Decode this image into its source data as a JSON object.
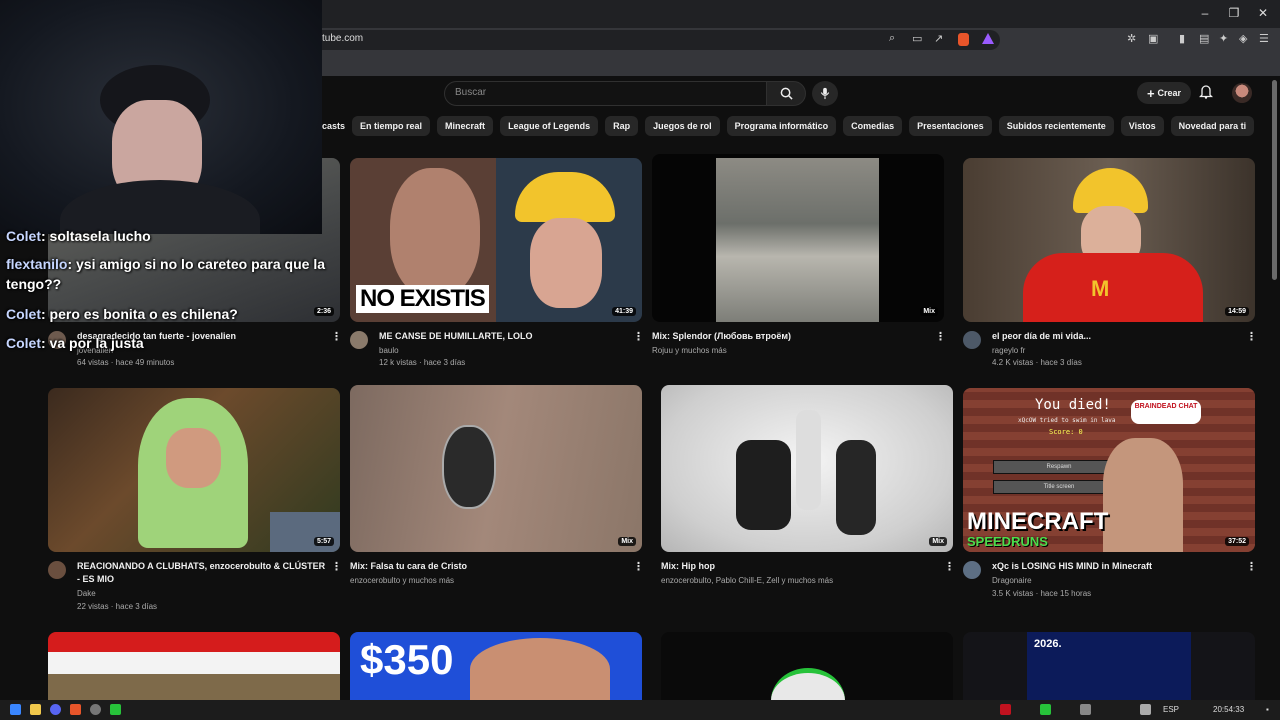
{
  "browser": {
    "url": "tube.com",
    "min": "–",
    "max": "❐",
    "close": "✕"
  },
  "header": {
    "search_placeholder": "Buscar",
    "create_label": "Crear"
  },
  "chips": [
    "casts",
    "En tiempo real",
    "Minecraft",
    "League of Legends",
    "Rap",
    "Juegos de rol",
    "Programa informático",
    "Comedias",
    "Presentaciones",
    "Subidos recientemente",
    "Vistos",
    "Novedad para ti"
  ],
  "videos": [
    {
      "title": "desagradecido tan fuerte - jovenalien",
      "channel": "jovenalien",
      "meta": "64 vistas · hace 49 minutos",
      "duration": "2:36"
    },
    {
      "title": "ME CANSE DE HUMILLARTE, LOLO",
      "channel": "baulo",
      "meta": "12 k vistas · hace 3 días",
      "duration": "41:39",
      "overlay": "NO EXISTIS"
    },
    {
      "title": "Mix: Splendor (Любовь втроём)",
      "channel": "Rojuu y muchos más",
      "meta": "",
      "duration": "Mix"
    },
    {
      "title": "el peor día de mi vida...",
      "channel": "rageylo fr",
      "meta": "4.2 K vistas · hace 3 días",
      "duration": "14:59"
    },
    {
      "title": "REACIONANDO A CLUBHATS, enzocerobulto & CLÚSTER - ES MIO",
      "channel": "Dake",
      "meta": "22 vistas · hace 3 días",
      "duration": "5:57"
    },
    {
      "title": "Mix: Falsa tu cara de Cristo",
      "channel": "enzocerobulto y muchos más",
      "meta": "",
      "duration": "Mix"
    },
    {
      "title": "Mix: Hip hop",
      "channel": "enzocerobulto, Pablo Chill-E, Zell y muchos más",
      "meta": "",
      "duration": "Mix"
    },
    {
      "title": "xQc is LOSING HIS MIND in Minecraft",
      "channel": "Dragonaire",
      "meta": "3.5 K vistas · hace 15 horas",
      "duration": "37:52",
      "overlay": "MINECRAFT",
      "overlay2": "SPEEDRUNS"
    }
  ],
  "bottom_thumbs": {
    "money": "$350",
    "year": "2026."
  },
  "game_text": {
    "died": "You died!",
    "sub": "xQcOW tried to swim in lava",
    "score": "Score: 0",
    "respawn": "Respawn",
    "title_screen": "Title screen",
    "braindead": "BRAINDEAD CHAT"
  },
  "chat": [
    {
      "name": "Colet",
      "text": ": soltasela lucho"
    },
    {
      "name": "flextanilo",
      "text": ": ysi amigo si no lo careteo para que la tengo??"
    },
    {
      "name": "Colet",
      "text": ": pero es bonita o es chilena?"
    },
    {
      "name": "Colet",
      "text": ": va por la justa"
    }
  ],
  "taskbar": {
    "lang": "ESP",
    "time": "20:54:33"
  },
  "colors": {
    "bg": "#0f0f0f",
    "chip": "#272727",
    "accent": "#ff0000"
  }
}
